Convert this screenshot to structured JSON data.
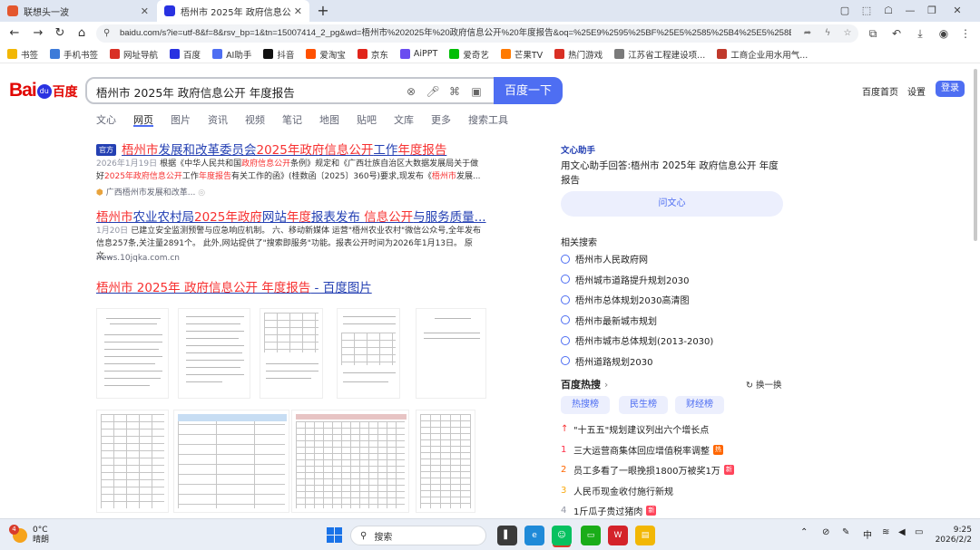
{
  "browser": {
    "tabs": [
      {
        "label": "联想头一波",
        "active": false
      },
      {
        "label": "梧州市 2025年 政府信息公开 年度",
        "active": true
      }
    ],
    "url": "baidu.com/s?ie=utf-8&f=8&rsv_bp=1&tn=15007414_2_pg&wd=梧州市%202025年%20政府信息公开%20年度报告&oq=%25E9%2595%25BF%25E5%2585%25B4%25E5%258E%25BF%2..."
  },
  "bookmarks": [
    {
      "label": "书签",
      "color": "#f2b705"
    },
    {
      "label": "手机书签",
      "color": "#3d7bd9"
    },
    {
      "label": "网址导航",
      "color": "#d93025"
    },
    {
      "label": "百度",
      "color": "#2932e1"
    },
    {
      "label": "AI助手",
      "color": "#4e6ef2"
    },
    {
      "label": "抖音",
      "color": "#111111"
    },
    {
      "label": "爱淘宝",
      "color": "#ff5000"
    },
    {
      "label": "京东",
      "color": "#e1251b"
    },
    {
      "label": "AiPPT",
      "color": "#6b4df0"
    },
    {
      "label": "爱奇艺",
      "color": "#00be06"
    },
    {
      "label": "芒果TV",
      "color": "#ff7a00"
    },
    {
      "label": "热门游戏",
      "color": "#d93025"
    },
    {
      "label": "江苏省工程建设项...",
      "color": "#7a7a7a"
    },
    {
      "label": "工商企业用水用气...",
      "color": "#c0392b"
    }
  ],
  "search": {
    "query": "梧州市 2025年 政府信息公开 年度报告",
    "button": "百度一下"
  },
  "header_links": {
    "home": "百度首页",
    "settings": "设置",
    "login": "登录"
  },
  "search_tabs": [
    "文心",
    "网页",
    "图片",
    "资讯",
    "视频",
    "笔记",
    "地图",
    "贴吧",
    "文库",
    "更多",
    "搜索工具"
  ],
  "results": {
    "r1": {
      "badge": "官方",
      "title_hl1": "梧州市",
      "title_p1": "发展和改革委员会",
      "title_hl2": "2025年政府信息公开",
      "title_p2": "工作",
      "title_hl3": "年度报告",
      "date": "2026年1月19日",
      "d1": "根据《中华人民共和国",
      "d_hl1": "政府信息公开",
      "d2": "条例》规定和《广西壮族自治区大数据发展局关于做好",
      "d_hl2": "2025年政府信息公开",
      "d3": "工作",
      "d_hl3": "年度报告",
      "d4": "有关工作的函》(桂数函〔2025〕360号)要求,现发布《",
      "d_hl4": "梧州市",
      "d5": "发展...",
      "source": "广西梧州市发展和改革..."
    },
    "r2": {
      "title_hl1": "梧州市",
      "title_p1": "农业农村局",
      "title_hl2": "2025年政府",
      "title_p2": "网站",
      "title_hl3": "年度",
      "title_p3": "报表发布 ",
      "title_hl4": "信息公开",
      "title_p4": "与服务质量...",
      "date": "1月20日",
      "desc": "已建立安全监测预警与应急响应机制。 六、移动新媒体 运营\"梧州农业农村\"微信公众号,全年发布信息257条,关注量2891个。 此外,网站提供了\"搜索即服务\"功能。报表公开时间为2026年1月13日。 原文...",
      "source": "news.10jqka.com.cn"
    },
    "r3": {
      "title_hl": "梧州市 2025年 政府信息公开 年度报告",
      "title_p": " - 百度图片"
    }
  },
  "right": {
    "ai_head": "文心助手",
    "ai_text": "用文心助手回答:梧州市 2025年 政府信息公开 年度报告",
    "ai_button": "问文心",
    "related_title": "相关搜索",
    "related": [
      "梧州市人民政府网",
      "梧州城市道路提升规划2030",
      "梧州市总体规划2030高清图",
      "梧州市最新城市规划",
      "梧州市城市总体规划(2013-2030)",
      "梧州道路规划2030"
    ],
    "hot_title": "百度热搜",
    "hot_refresh": "换一换",
    "hot_pills": [
      "热搜榜",
      "民生榜",
      "财经榜"
    ],
    "hot_items": [
      {
        "rank": "↑",
        "text": "\"十五五\"规划建议列出六个增长点",
        "tag": "",
        "tag_color": ""
      },
      {
        "rank": "1",
        "text": "三大运营商集体回应增值税率调整",
        "tag": "热",
        "tag_color": "#ff6600"
      },
      {
        "rank": "2",
        "text": "员工多看了一眼挽损1800万被奖1万",
        "tag": "新",
        "tag_color": "#ff455b"
      },
      {
        "rank": "3",
        "text": "人民币现金收付施行新规",
        "tag": "",
        "tag_color": ""
      },
      {
        "rank": "4",
        "text": "1斤瓜子贵过猪肉",
        "tag": "新",
        "tag_color": "#ff455b"
      }
    ]
  },
  "taskbar": {
    "badge": "4",
    "temp": "0°C",
    "weather": "晴朗",
    "search": "搜索",
    "ime": "中",
    "time": "9:25",
    "date": "2026/2/2"
  }
}
